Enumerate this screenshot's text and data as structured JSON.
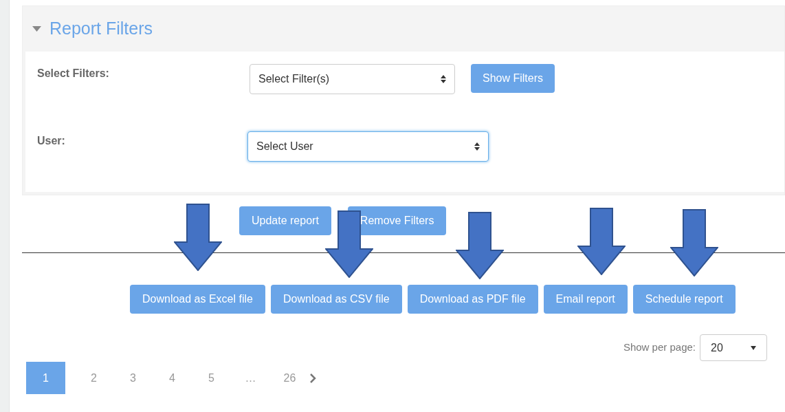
{
  "panel": {
    "title": "Report Filters",
    "expanded": true,
    "fields": [
      {
        "label": "Select Filters:",
        "value": "Select Filter(s)",
        "focused": false,
        "button": "Show Filters"
      },
      {
        "label": "User:",
        "value": "Select User",
        "focused": true
      }
    ]
  },
  "actions": [
    "Update report",
    "Remove Filters"
  ],
  "exports": [
    "Download as Excel file",
    "Download as CSV file",
    "Download as PDF file",
    "Email report",
    "Schedule report"
  ],
  "per_page": {
    "label": "Show per page:",
    "value": "20"
  },
  "pagination": [
    {
      "label": "1",
      "selected": true
    },
    {
      "label": "2",
      "selected": false
    },
    {
      "label": "3",
      "selected": false
    },
    {
      "label": "4",
      "selected": false
    },
    {
      "label": "5",
      "selected": false
    },
    {
      "label": "…",
      "selected": false
    },
    {
      "label": "26",
      "selected": false
    }
  ],
  "annotations": [
    {
      "kind": "arrow"
    },
    {
      "kind": "arrow"
    },
    {
      "kind": "arrow"
    },
    {
      "kind": "arrow"
    },
    {
      "kind": "arrow"
    }
  ]
}
